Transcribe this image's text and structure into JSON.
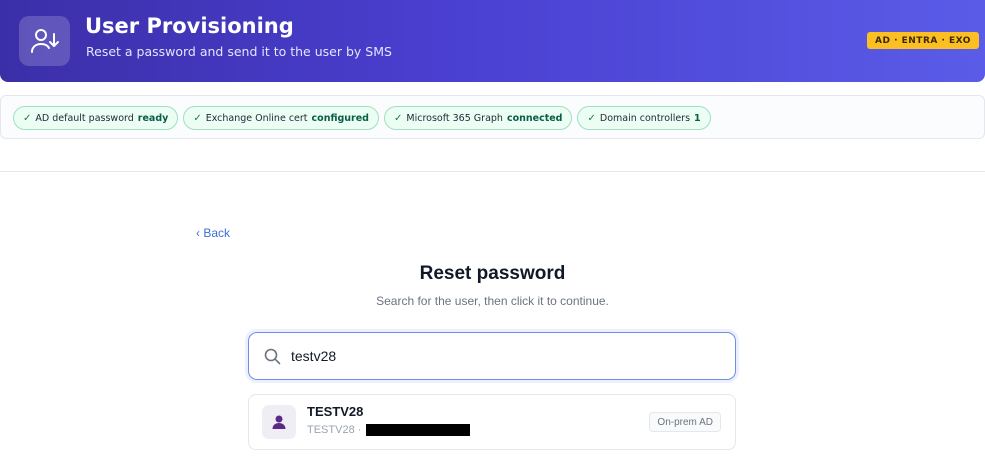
{
  "header": {
    "title": "User Provisioning",
    "subtitle": "Reset a password and send it to the user by SMS",
    "badge": "AD · ENTRA · EXO",
    "icon": "user-arrow-down-icon",
    "gradient": [
      "#3b2fa8",
      "#5a5ce8"
    ],
    "badge_color": "#fbbf24"
  },
  "status_chips": [
    {
      "label": "AD default password",
      "value": "ready"
    },
    {
      "label": "Exchange Online cert",
      "value": "configured"
    },
    {
      "label": "Microsoft 365 Graph",
      "value": "connected"
    },
    {
      "label": "Domain controllers",
      "value": "1"
    }
  ],
  "nav": {
    "back_label": "‹ Back"
  },
  "panel": {
    "title": "Reset password",
    "subtitle": "Search for the user, then click it to continue."
  },
  "search": {
    "value": "testv28",
    "placeholder": ""
  },
  "results": [
    {
      "name": "TESTV28",
      "sub_prefix": "TESTV28 ·",
      "tag": "On-prem AD",
      "icon": "user-icon"
    }
  ],
  "colors": {
    "accent": "#3b6fd8",
    "success": "#15803d",
    "avatar": "#5b2a86"
  }
}
